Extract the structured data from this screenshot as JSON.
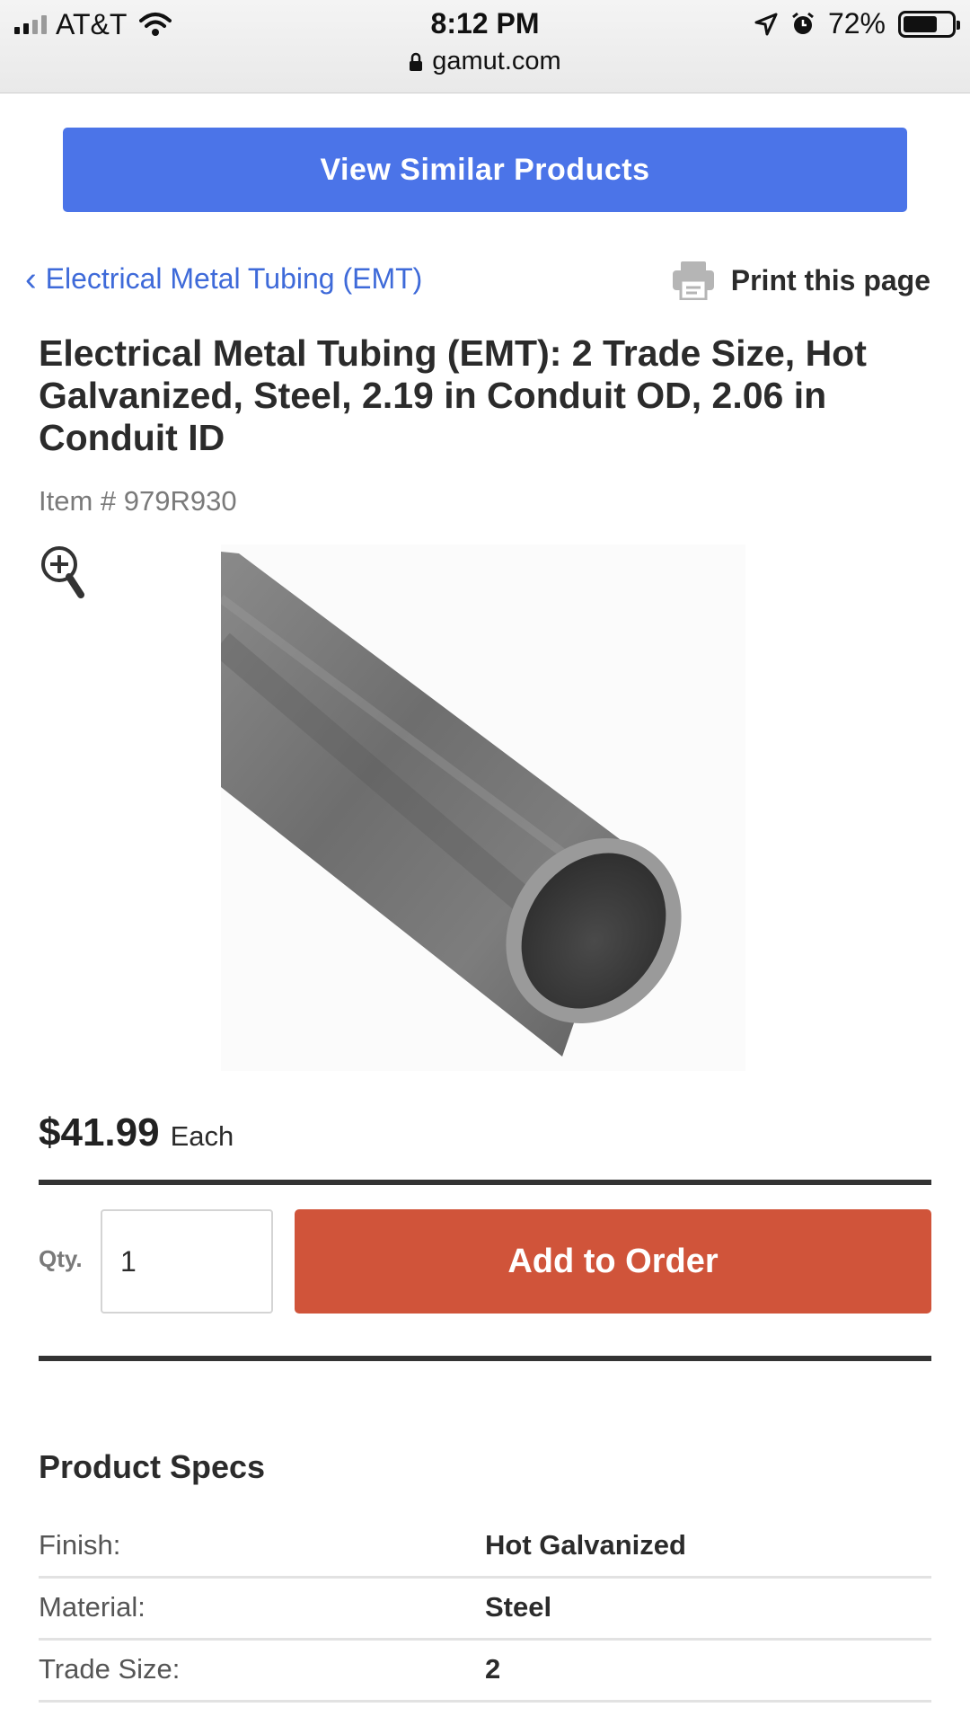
{
  "status_bar": {
    "carrier": "AT&T",
    "time": "8:12 PM",
    "battery": "72%",
    "battery_level": 0.72,
    "url": "gamut.com"
  },
  "actions": {
    "view_similar": "View Similar Products",
    "print": "Print this page",
    "add_to_order": "Add to Order"
  },
  "breadcrumb": {
    "chevron": "‹",
    "label": "Electrical Metal Tubing (EMT)"
  },
  "product": {
    "title": "Electrical Metal Tubing (EMT): 2 Trade Size, Hot Galvanized, Steel, 2.19 in Conduit OD, 2.06 in Conduit ID",
    "item_number": "Item # 979R930",
    "price": "$41.99",
    "price_unit": "Each",
    "image_alt": "Steel conduit tube"
  },
  "order": {
    "qty_label": "Qty.",
    "qty_value": "1"
  },
  "specs": {
    "title": "Product Specs",
    "rows": [
      {
        "label": "Finish:",
        "value": "Hot Galvanized"
      },
      {
        "label": "Material:",
        "value": "Steel"
      },
      {
        "label": "Trade Size:",
        "value": "2"
      }
    ]
  },
  "icons": {
    "zoom": "zoom-in-icon",
    "print": "printer-icon",
    "lock": "lock-icon"
  },
  "colors": {
    "primary_blue": "#4b74e8",
    "link_blue": "#3e6ad9",
    "add_button": "#d0543a"
  }
}
